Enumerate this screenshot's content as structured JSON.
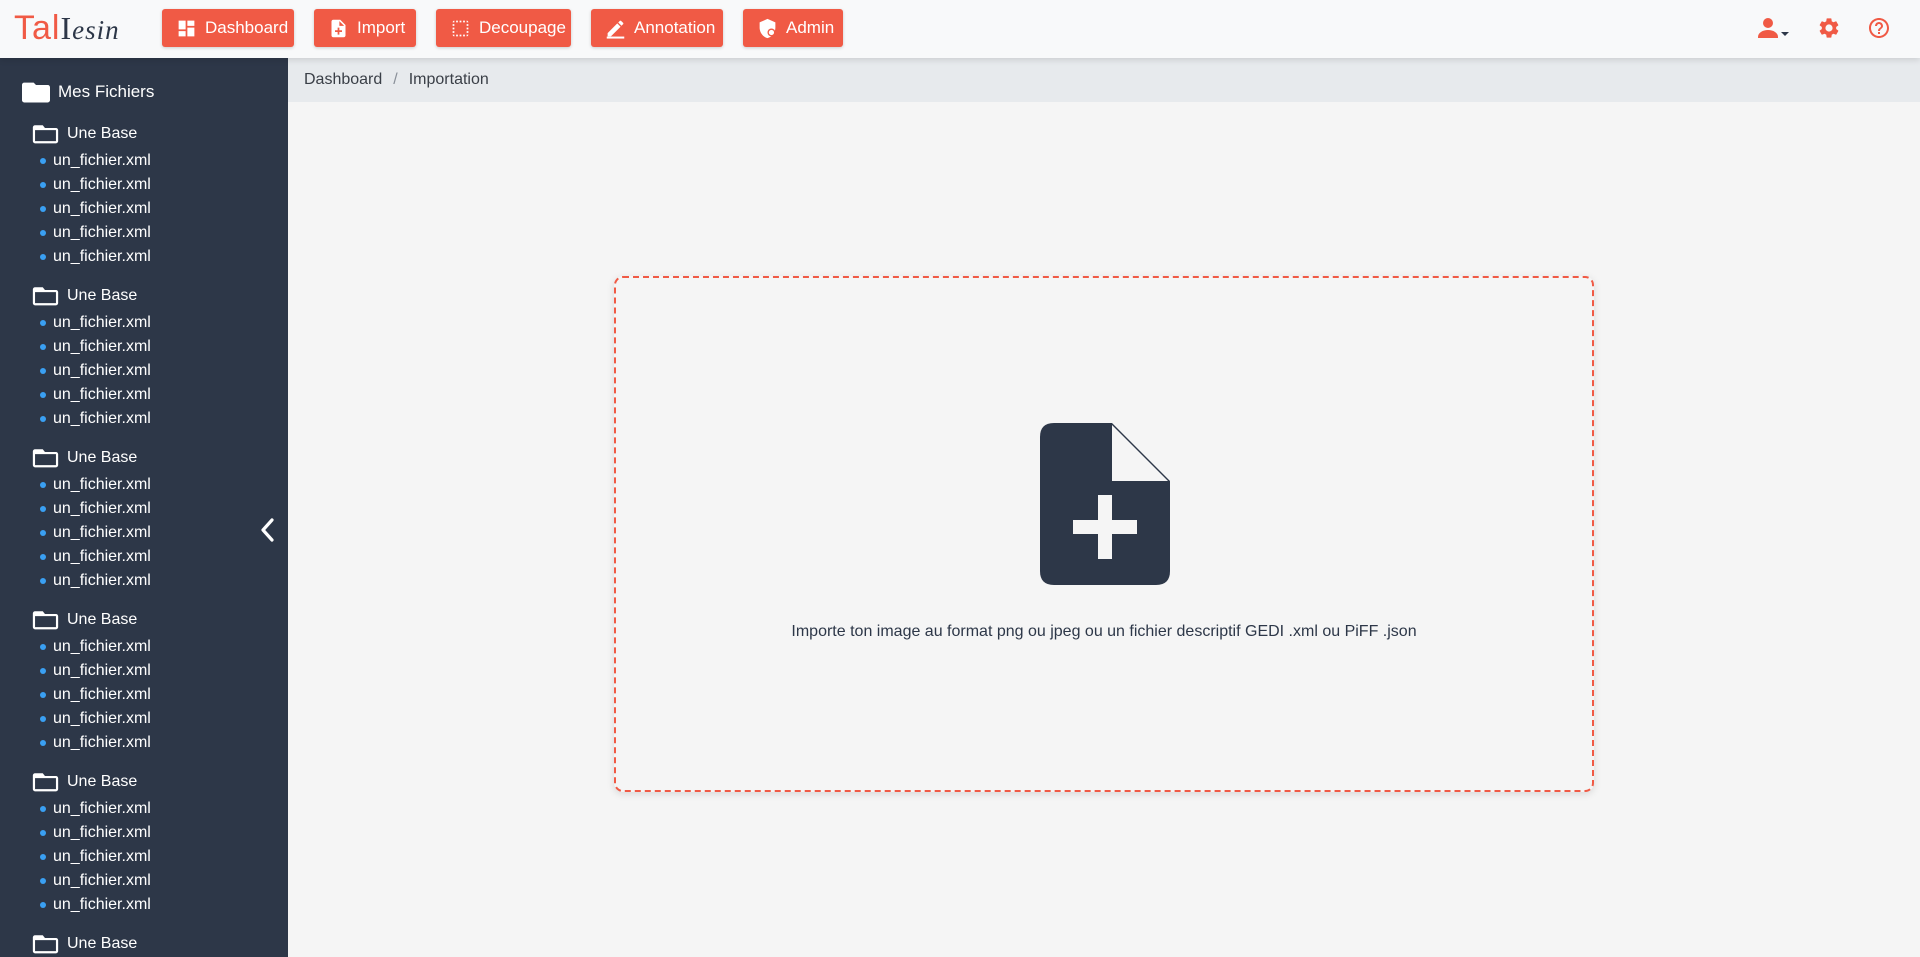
{
  "app": {
    "logo_part1": "Tal",
    "logo_part2_I": "I",
    "logo_part2_rest": "esin"
  },
  "colors": {
    "accent": "#f05a45",
    "sidebar_bg": "#2d3748",
    "bullet": "#3aa0f3",
    "breadcrumb_bg": "#e7eaed",
    "page_bg": "#f5f5f5"
  },
  "nav": {
    "dashboard": "Dashboard",
    "import": "Import",
    "decoupage": "Decoupage",
    "annotation": "Annotation",
    "admin": "Admin"
  },
  "header_icons": [
    "user-icon",
    "gear-icon",
    "help-icon"
  ],
  "sidebar": {
    "root_label": "Mes Fichiers",
    "folders": [
      {
        "label": "Une Base",
        "files": [
          "un_fichier.xml",
          "un_fichier.xml",
          "un_fichier.xml",
          "un_fichier.xml",
          "un_fichier.xml"
        ]
      },
      {
        "label": "Une Base",
        "files": [
          "un_fichier.xml",
          "un_fichier.xml",
          "un_fichier.xml",
          "un_fichier.xml",
          "un_fichier.xml"
        ]
      },
      {
        "label": "Une Base",
        "files": [
          "un_fichier.xml",
          "un_fichier.xml",
          "un_fichier.xml",
          "un_fichier.xml",
          "un_fichier.xml"
        ]
      },
      {
        "label": "Une Base",
        "files": [
          "un_fichier.xml",
          "un_fichier.xml",
          "un_fichier.xml",
          "un_fichier.xml",
          "un_fichier.xml"
        ]
      },
      {
        "label": "Une Base",
        "files": [
          "un_fichier.xml",
          "un_fichier.xml",
          "un_fichier.xml",
          "un_fichier.xml",
          "un_fichier.xml"
        ]
      },
      {
        "label": "Une Base",
        "files": []
      }
    ]
  },
  "breadcrumb": {
    "items": [
      "Dashboard",
      "Importation"
    ],
    "separator": "/"
  },
  "dropzone": {
    "icon": "file-add-icon",
    "text": "Importe ton image au format png ou jpeg ou un fichier descriptif GEDI .xml ou PiFF .json"
  }
}
